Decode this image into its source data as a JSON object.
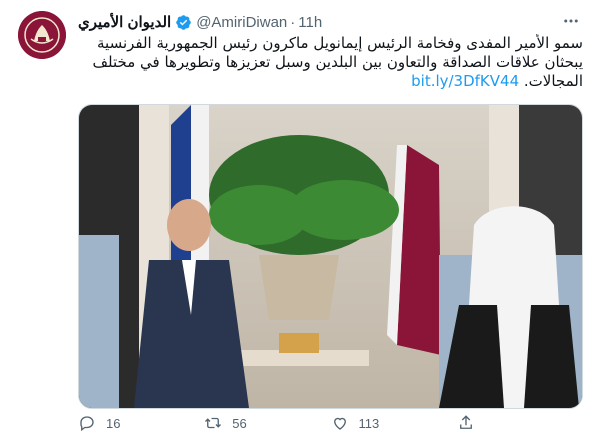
{
  "author": {
    "display_name": "الديوان الأميري",
    "handle": "@AmiriDiwan",
    "separator": "·",
    "time": "11h"
  },
  "tweet": {
    "line1": "سمو الأمير المفدى وفخامة الرئيس إيمانويل ماكرون رئيس الجمهورية الفرنسية",
    "line2": "يبحثان علاقات الصداقة والتعاون بين البلدين وسبل تعزيزها وتطويرها في مختلف",
    "line3_text": "المجالات. ",
    "link": "bit.ly/3DfKV44"
  },
  "actions": {
    "replies": "16",
    "retweets": "56",
    "likes": "113"
  },
  "colors": {
    "accent": "#1d9bf0",
    "muted": "#536471",
    "avatar_bg": "#8a1538",
    "qatar_maroon": "#8a1538"
  },
  "icons": {
    "verified": "verified-badge-icon",
    "more": "more-dots-icon",
    "reply": "reply-icon",
    "retweet": "retweet-icon",
    "like": "like-icon",
    "share": "share-icon"
  }
}
